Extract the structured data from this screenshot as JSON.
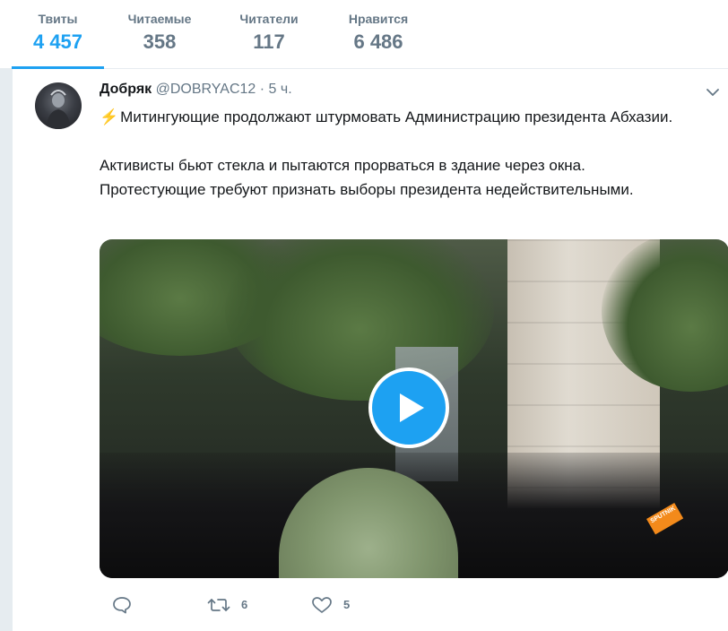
{
  "stats": [
    {
      "label": "Твиты",
      "value": "4 457",
      "active": true
    },
    {
      "label": "Читаемые",
      "value": "358"
    },
    {
      "label": "Читатели",
      "value": "117"
    },
    {
      "label": "Нравится",
      "value": "6 486"
    }
  ],
  "tweet": {
    "name": "Добряк",
    "handle": "@DOBRYAC12",
    "separator": "·",
    "time": "5 ч.",
    "emoji": "⚡",
    "paragraph1": "Митингующие продолжают штурмовать Администрацию президента Абхазии.",
    "paragraph2_line1": "Активисты бьют стекла и пытаются прорваться в здание через окна.",
    "paragraph2_line2": "Протестующие требуют признать выборы президента недействительными.",
    "media": {
      "watermark": "SPUTNIK"
    },
    "actions": {
      "reply_icon": "reply-icon",
      "retweet_icon": "retweet-icon",
      "retweet_count": "6",
      "like_icon": "heart-icon",
      "like_count": "5"
    }
  },
  "colors": {
    "accent": "#1da1f2",
    "muted": "#657786",
    "text": "#14171a"
  }
}
